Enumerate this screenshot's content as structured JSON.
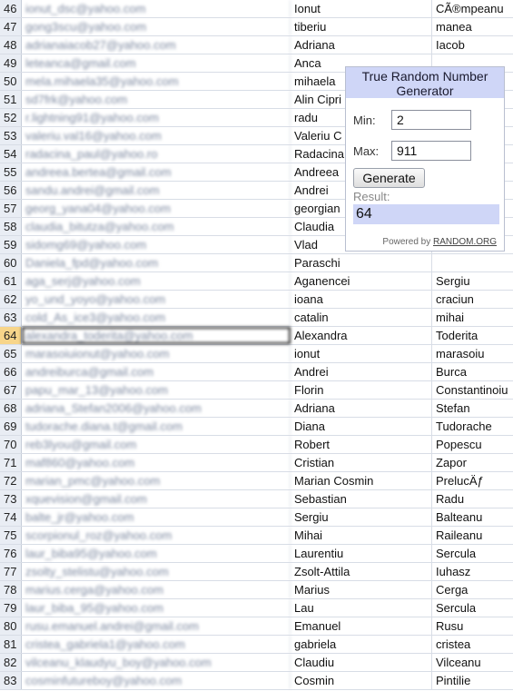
{
  "sheet": {
    "active_row": "64",
    "rows": [
      {
        "n": "46",
        "email": "ionut_dsc@yahoo.com",
        "first": "Ionut",
        "last": "CÃ®mpeanu"
      },
      {
        "n": "47",
        "email": "gong3scu@yahoo.com",
        "first": "tiberiu",
        "last": "manea"
      },
      {
        "n": "48",
        "email": "adrianaiacob27@yahoo.com",
        "first": "Adriana",
        "last": "Iacob"
      },
      {
        "n": "49",
        "email": "leteanca@gmail.com",
        "first": "Anca",
        "last": ""
      },
      {
        "n": "50",
        "email": "mela.mihaela35@yahoo.com",
        "first": "mihaela",
        "last": ""
      },
      {
        "n": "51",
        "email": "sd7frk@yahoo.com",
        "first": "Alin Cipri",
        "last": ""
      },
      {
        "n": "52",
        "email": "r.lightning91@yahoo.com",
        "first": "radu",
        "last": ""
      },
      {
        "n": "53",
        "email": "valeriu.val16@yahoo.com",
        "first": "Valeriu C",
        "last": ""
      },
      {
        "n": "54",
        "email": "radacina_paul@yahoo.ro",
        "first": "Radacina",
        "last": ""
      },
      {
        "n": "55",
        "email": "andreea.bertea@gmail.com",
        "first": "Andreea",
        "last": ""
      },
      {
        "n": "56",
        "email": "sandu.andrei@gmail.com",
        "first": "Andrei",
        "last": ""
      },
      {
        "n": "57",
        "email": "georg_yana04@yahoo.com",
        "first": "georgian",
        "last": ""
      },
      {
        "n": "58",
        "email": "claudia_bitutza@yahoo.com",
        "first": "Claudia",
        "last": ""
      },
      {
        "n": "59",
        "email": "sidomg69@yahoo.com",
        "first": "Vlad",
        "last": ""
      },
      {
        "n": "60",
        "email": "Daniela_fpd@yahoo.com",
        "first": "Paraschi",
        "last": ""
      },
      {
        "n": "61",
        "email": "aga_serj@yahoo.com",
        "first": "Aganencei",
        "last": "Sergiu"
      },
      {
        "n": "62",
        "email": "yo_und_yoyo@yahoo.com",
        "first": "ioana",
        "last": "craciun"
      },
      {
        "n": "63",
        "email": "cold_As_ice3@yahoo.com",
        "first": "catalin",
        "last": "mihai"
      },
      {
        "n": "64",
        "email": "alexandra_toderita@yahoo.com",
        "first": "Alexandra",
        "last": "Toderita"
      },
      {
        "n": "65",
        "email": "marasoiuionut@yahoo.com",
        "first": "ionut",
        "last": "marasoiu"
      },
      {
        "n": "66",
        "email": "andreiburca@gmail.com",
        "first": "Andrei",
        "last": "Burca"
      },
      {
        "n": "67",
        "email": "papu_mar_13@yahoo.com",
        "first": "Florin",
        "last": "Constantinoiu"
      },
      {
        "n": "68",
        "email": "adriana_Stefan2006@yahoo.com",
        "first": "Adriana",
        "last": "Stefan"
      },
      {
        "n": "69",
        "email": "tudorache.diana.t@gmail.com",
        "first": "Diana",
        "last": "Tudorache"
      },
      {
        "n": "70",
        "email": "reb3lyou@gmail.com",
        "first": "Robert",
        "last": "Popescu"
      },
      {
        "n": "71",
        "email": "maf860@yahoo.com",
        "first": "Cristian",
        "last": "Zapor"
      },
      {
        "n": "72",
        "email": "marian_pmc@yahoo.com",
        "first": "Marian Cosmin",
        "last": "PrelucÄƒ"
      },
      {
        "n": "73",
        "email": "xquevision@gmail.com",
        "first": "Sebastian",
        "last": "Radu"
      },
      {
        "n": "74",
        "email": "balte_jr@yahoo.com",
        "first": "Sergiu",
        "last": "Balteanu"
      },
      {
        "n": "75",
        "email": "scorpionul_roz@yahoo.com",
        "first": "Mihai",
        "last": "Raileanu"
      },
      {
        "n": "76",
        "email": "laur_biba95@yahoo.com",
        "first": "Laurentiu",
        "last": "Sercula"
      },
      {
        "n": "77",
        "email": "zsolty_stelistu@yahoo.com",
        "first": "Zsolt-Attila",
        "last": "Iuhasz"
      },
      {
        "n": "78",
        "email": "marius.cerga@yahoo.com",
        "first": "Marius",
        "last": "Cerga"
      },
      {
        "n": "79",
        "email": "laur_biba_95@yahoo.com",
        "first": "Lau",
        "last": "Sercula"
      },
      {
        "n": "80",
        "email": "rusu.emanuel.andrei@gmail.com",
        "first": "Emanuel",
        "last": "Rusu"
      },
      {
        "n": "81",
        "email": "cristea_gabriela1@yahoo.com",
        "first": "gabriela",
        "last": "cristea"
      },
      {
        "n": "82",
        "email": "vilceanu_klaudyu_boy@yahoo.com",
        "first": "Claudiu",
        "last": "Vilceanu"
      },
      {
        "n": "83",
        "email": "cosminfutureboy@yahoo.com",
        "first": "Cosmin",
        "last": "Pintilie"
      }
    ]
  },
  "rng": {
    "title": "True Random Number Generator",
    "min_label": "Min:",
    "min_value": "2",
    "max_label": "Max:",
    "max_value": "911",
    "generate_label": "Generate",
    "result_label": "Result:",
    "result_value": "64",
    "powered_by": "Powered by",
    "powered_link": "RANDOM.ORG"
  },
  "colors": {
    "row_header_bg": "#e9edf4",
    "active_row_header_bg": "#f7d58a",
    "widget_accent": "#cfd6f7"
  }
}
